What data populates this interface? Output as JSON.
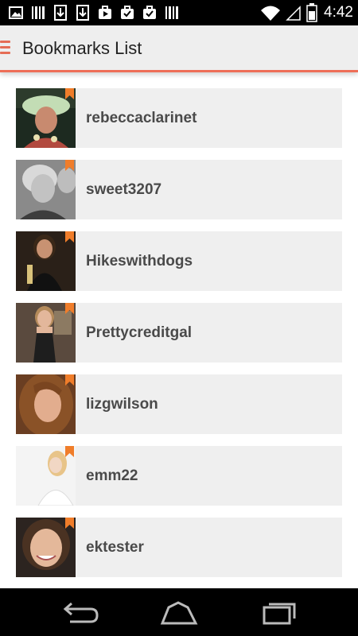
{
  "status_bar": {
    "time": "4:42",
    "left_icons": [
      "gallery-icon",
      "barcode-icon",
      "download-icon",
      "download-icon",
      "video-bag-icon",
      "checklist-bag-icon",
      "check-bag-icon",
      "barcode-icon"
    ],
    "right_icons": [
      "wifi-icon",
      "no-signal-icon",
      "battery-icon"
    ]
  },
  "app_bar": {
    "title": "Bookmarks List",
    "menu_icon": "hamburger-menu-icon",
    "accent_color": "#ee6e57"
  },
  "bookmarks": [
    {
      "name": "rebeccaclarinet"
    },
    {
      "name": "sweet3207"
    },
    {
      "name": "Hikeswithdogs"
    },
    {
      "name": "Prettycreditgal"
    },
    {
      "name": "lizgwilson"
    },
    {
      "name": "emm22"
    },
    {
      "name": "ektester"
    }
  ],
  "nav_bar": {
    "buttons": [
      "back-icon",
      "home-icon",
      "recents-icon"
    ]
  }
}
